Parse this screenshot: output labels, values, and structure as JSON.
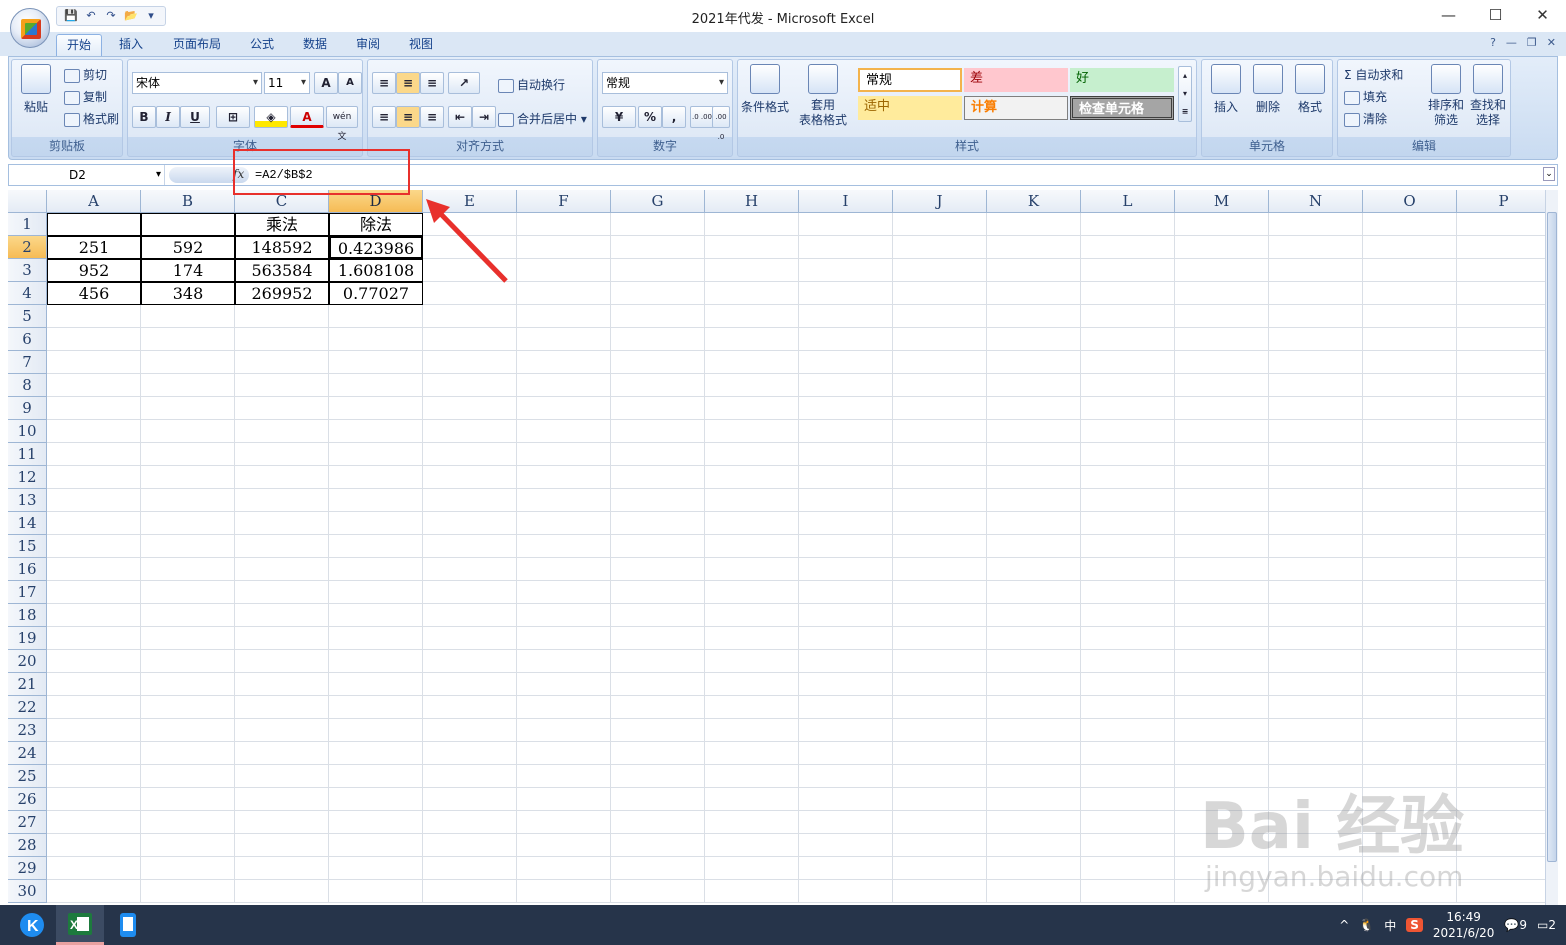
{
  "window": {
    "title": "2021年代发 - Microsoft Excel"
  },
  "tabs": [
    "开始",
    "插入",
    "页面布局",
    "公式",
    "数据",
    "审阅",
    "视图"
  ],
  "clipboard": {
    "paste": "粘贴",
    "cut": "剪切",
    "copy": "复制",
    "format_painter": "格式刷",
    "label": "剪贴板"
  },
  "font": {
    "name": "宋体",
    "size": "11",
    "bold": "B",
    "italic": "I",
    "underline": "U",
    "grow": "A",
    "shrink": "A",
    "font_color": "A",
    "phonetic": "wén 文",
    "label": "字体"
  },
  "alignment": {
    "wrap": "自动换行",
    "merge": "合并后居中",
    "label": "对齐方式"
  },
  "number": {
    "format": "常规",
    "percent": "%",
    "comma": ",",
    "inc": ".0 .00",
    "dec": ".00 .0",
    "label": "数字"
  },
  "styles": {
    "cond": "条件格式",
    "table": "套用\n表格格式",
    "normal": "常规",
    "bad": "差",
    "good": "好",
    "neutral": "适中",
    "calc": "计算",
    "check": "检查单元格",
    "label": "样式"
  },
  "cells": {
    "insert": "插入",
    "delete": "删除",
    "format": "格式",
    "label": "单元格"
  },
  "editing": {
    "autosum": "Σ 自动求和",
    "fill": "填充",
    "clear": "清除",
    "sort": "排序和\n筛选",
    "find": "查找和\n选择",
    "label": "编辑"
  },
  "formula_bar": {
    "name_box": "D2",
    "fx": "fx",
    "formula": "=A2/$B$2"
  },
  "columns": [
    "A",
    "B",
    "C",
    "D",
    "E",
    "F",
    "G",
    "H",
    "I",
    "J",
    "K",
    "L",
    "M",
    "N",
    "O",
    "P"
  ],
  "rows": [
    "1",
    "2",
    "3",
    "4",
    "5",
    "6",
    "7",
    "8",
    "9",
    "10",
    "11",
    "12",
    "13",
    "14",
    "15",
    "16",
    "17",
    "18",
    "19",
    "20",
    "21",
    "22",
    "23",
    "24",
    "25",
    "26",
    "27",
    "28",
    "29",
    "30"
  ],
  "sheet": {
    "r1": [
      "",
      "",
      "乘法",
      "除法"
    ],
    "r2": [
      "251",
      "592",
      "148592",
      "0.423986"
    ],
    "r3": [
      "952",
      "174",
      "563584",
      "1.608108"
    ],
    "r4": [
      "456",
      "348",
      "269952",
      "0.77027"
    ]
  },
  "taskbar": {
    "time": "16:49",
    "date": "2021/6/20",
    "ime": "中",
    "notif": "9",
    "notif2": "2"
  },
  "watermark": {
    "brand": "Bai 经验",
    "url": "jingyan.baidu.com"
  }
}
